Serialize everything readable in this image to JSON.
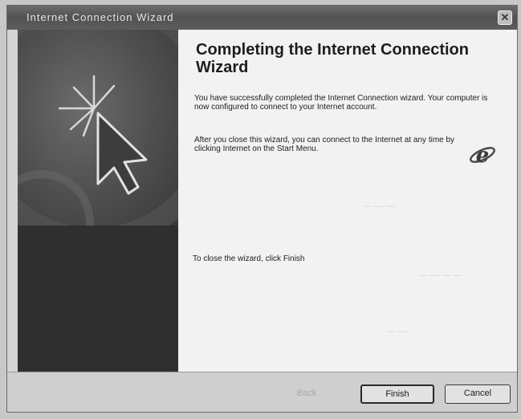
{
  "window": {
    "title": "Internet Connection Wizard",
    "close_symbol": "✕"
  },
  "content": {
    "heading": "Completing the Internet Connection Wizard",
    "paragraph1": "You have successfully completed the Internet Connection wizard. Your computer is now configured to connect to your Internet account.",
    "paragraph2": "After you close this wizard, you can connect to the Internet at any time by clicking Internet on the Start Menu.",
    "closing_instruction": "To close the wizard, click Finish"
  },
  "buttons": {
    "back_label": "Back",
    "finish_label": "Finish",
    "cancel_label": "Cancel"
  },
  "icons": {
    "left_art": "cursor-starburst-icon",
    "ie": "internet-explorer-icon",
    "close": "close-icon"
  },
  "colors": {
    "titlebar": "#5d5d5d",
    "left_panel_dark": "#2f2f2f",
    "content_bg": "#f2f2f2"
  }
}
